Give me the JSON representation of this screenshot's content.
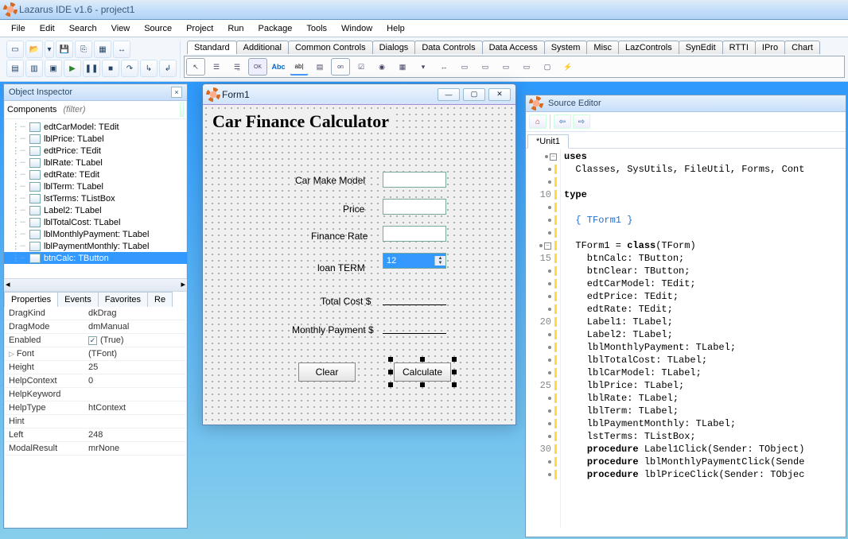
{
  "window_title": "Lazarus IDE v1.6 - project1",
  "menus": [
    "File",
    "Edit",
    "Search",
    "View",
    "Source",
    "Project",
    "Run",
    "Package",
    "Tools",
    "Window",
    "Help"
  ],
  "component_tabs": [
    "Standard",
    "Additional",
    "Common Controls",
    "Dialogs",
    "Data Controls",
    "Data Access",
    "System",
    "Misc",
    "LazControls",
    "SynEdit",
    "RTTI",
    "IPro",
    "Chart"
  ],
  "component_tabs_active": 0,
  "object_inspector": {
    "title": "Object Inspector",
    "components_label": "Components",
    "filter_placeholder": "(filter)",
    "tree": [
      "edtCarModel: TEdit",
      "lblPrice: TLabel",
      "edtPrice: TEdit",
      "lblRate: TLabel",
      "edtRate: TEdit",
      "lblTerm: TLabel",
      "lstTerms: TListBox",
      "Label2: TLabel",
      "lblTotalCost: TLabel",
      "lblMonthlyPayment: TLabel",
      "lblPaymentMonthly: TLabel",
      "btnCalc: TButton"
    ],
    "tree_selected": 11,
    "prop_tabs": [
      "Properties",
      "Events",
      "Favorites",
      "Re"
    ],
    "prop_tabs_active": 0,
    "props": [
      {
        "k": "DragKind",
        "v": "dkDrag"
      },
      {
        "k": "DragMode",
        "v": "dmManual"
      },
      {
        "k": "Enabled",
        "v": "(True)",
        "chk": true
      },
      {
        "k": "Font",
        "v": "(TFont)",
        "tri": true
      },
      {
        "k": "Height",
        "v": "25"
      },
      {
        "k": "HelpContext",
        "v": "0"
      },
      {
        "k": "HelpKeyword",
        "v": ""
      },
      {
        "k": "HelpType",
        "v": "htContext"
      },
      {
        "k": "Hint",
        "v": ""
      },
      {
        "k": "Left",
        "v": "248"
      },
      {
        "k": "ModalResult",
        "v": "mrNone"
      }
    ]
  },
  "form": {
    "caption": "Form1",
    "heading": "Car Finance Calculator",
    "labels": {
      "car_model": "Car Make Model",
      "price": "Price",
      "rate": "Finance Rate",
      "term": "loan TERM",
      "total_prefix": "Total Cost  $",
      "monthly_prefix": "Monthly Payment $"
    },
    "list_value": "12",
    "btn_clear": "Clear",
    "btn_calc": "Calculate"
  },
  "source": {
    "title": "Source Editor",
    "tab": "*Unit1",
    "lines_with_num": {
      "10": "type",
      "15": "    btnCalc: TButton;",
      "20": "    edtRate: TEdit;",
      "25": "    lblPrice: TLabel;",
      "30": "    procedure Label1Click(Sender: TObject)"
    },
    "code": [
      {
        "t": "kw",
        "s": "uses"
      },
      {
        "t": "",
        "s": "  Classes, SysUtils, FileUtil, Forms, Cont"
      },
      {
        "t": "",
        "s": ""
      },
      {
        "t": "kw",
        "s": "type"
      },
      {
        "t": "",
        "s": ""
      },
      {
        "t": "cm2",
        "s": "  { TForm1 }"
      },
      {
        "t": "",
        "s": ""
      },
      {
        "t": "mix",
        "s": "  TForm1 = class(TForm)"
      },
      {
        "t": "",
        "s": "    btnCalc: TButton;"
      },
      {
        "t": "",
        "s": "    btnClear: TButton;"
      },
      {
        "t": "",
        "s": "    edtCarModel: TEdit;"
      },
      {
        "t": "",
        "s": "    edtPrice: TEdit;"
      },
      {
        "t": "",
        "s": "    edtRate: TEdit;"
      },
      {
        "t": "",
        "s": "    Label1: TLabel;"
      },
      {
        "t": "",
        "s": "    Label2: TLabel;"
      },
      {
        "t": "",
        "s": "    lblMonthlyPayment: TLabel;"
      },
      {
        "t": "",
        "s": "    lblTotalCost: TLabel;"
      },
      {
        "t": "",
        "s": "    lblCarModel: TLabel;"
      },
      {
        "t": "",
        "s": "    lblPrice: TLabel;"
      },
      {
        "t": "",
        "s": "    lblRate: TLabel;"
      },
      {
        "t": "",
        "s": "    lblTerm: TLabel;"
      },
      {
        "t": "",
        "s": "    lblPaymentMonthly: TLabel;"
      },
      {
        "t": "",
        "s": "    lstTerms: TListBox;"
      },
      {
        "t": "mix2",
        "s": "    procedure Label1Click(Sender: TObject)"
      },
      {
        "t": "mix2",
        "s": "    procedure lblMonthlyPaymentClick(Sende"
      },
      {
        "t": "mix2",
        "s": "    procedure lblPriceClick(Sender: TObjec"
      }
    ]
  }
}
